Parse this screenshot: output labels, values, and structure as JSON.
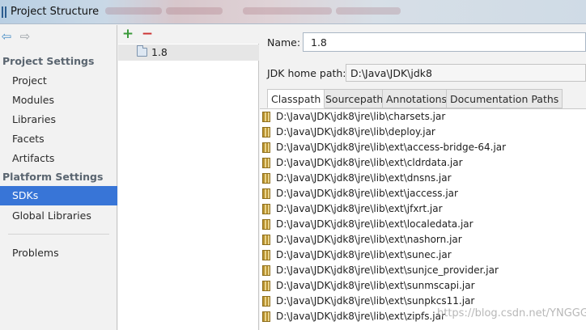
{
  "window": {
    "title": "Project Structure"
  },
  "nav": {
    "sections": [
      {
        "heading": "Project Settings",
        "items": [
          "Project",
          "Modules",
          "Libraries",
          "Facets",
          "Artifacts"
        ]
      },
      {
        "heading": "Platform Settings",
        "items": [
          "SDKs",
          "Global Libraries"
        ]
      }
    ],
    "selected": "SDKs",
    "problems": "Problems"
  },
  "sdk_list": {
    "items": [
      "1.8"
    ],
    "selected": "1.8"
  },
  "detail": {
    "name_label": "Name:",
    "name_value": "1.8",
    "home_label": "JDK home path:",
    "home_value": "D:\\Java\\JDK\\jdk8",
    "tabs": [
      "Classpath",
      "Sourcepath",
      "Annotations",
      "Documentation Paths"
    ],
    "active_tab": "Classpath",
    "classpath": [
      "D:\\Java\\JDK\\jdk8\\jre\\lib\\charsets.jar",
      "D:\\Java\\JDK\\jdk8\\jre\\lib\\deploy.jar",
      "D:\\Java\\JDK\\jdk8\\jre\\lib\\ext\\access-bridge-64.jar",
      "D:\\Java\\JDK\\jdk8\\jre\\lib\\ext\\cldrdata.jar",
      "D:\\Java\\JDK\\jdk8\\jre\\lib\\ext\\dnsns.jar",
      "D:\\Java\\JDK\\jdk8\\jre\\lib\\ext\\jaccess.jar",
      "D:\\Java\\JDK\\jdk8\\jre\\lib\\ext\\jfxrt.jar",
      "D:\\Java\\JDK\\jdk8\\jre\\lib\\ext\\localedata.jar",
      "D:\\Java\\JDK\\jdk8\\jre\\lib\\ext\\nashorn.jar",
      "D:\\Java\\JDK\\jdk8\\jre\\lib\\ext\\sunec.jar",
      "D:\\Java\\JDK\\jdk8\\jre\\lib\\ext\\sunjce_provider.jar",
      "D:\\Java\\JDK\\jdk8\\jre\\lib\\ext\\sunmscapi.jar",
      "D:\\Java\\JDK\\jdk8\\jre\\lib\\ext\\sunpkcs11.jar",
      "D:\\Java\\JDK\\jdk8\\jre\\lib\\ext\\zipfs.jar"
    ]
  },
  "watermark": "https://blog.csdn.net/YNGGG",
  "colors": {
    "selection": "#3875d7",
    "add": "#3a9a3a",
    "remove": "#cc3333"
  },
  "icons": {
    "back": "arrow-left-icon",
    "forward": "arrow-right-icon",
    "add": "plus-icon",
    "remove": "minus-icon",
    "sdk": "folder-icon",
    "jar": "jar-icon"
  }
}
